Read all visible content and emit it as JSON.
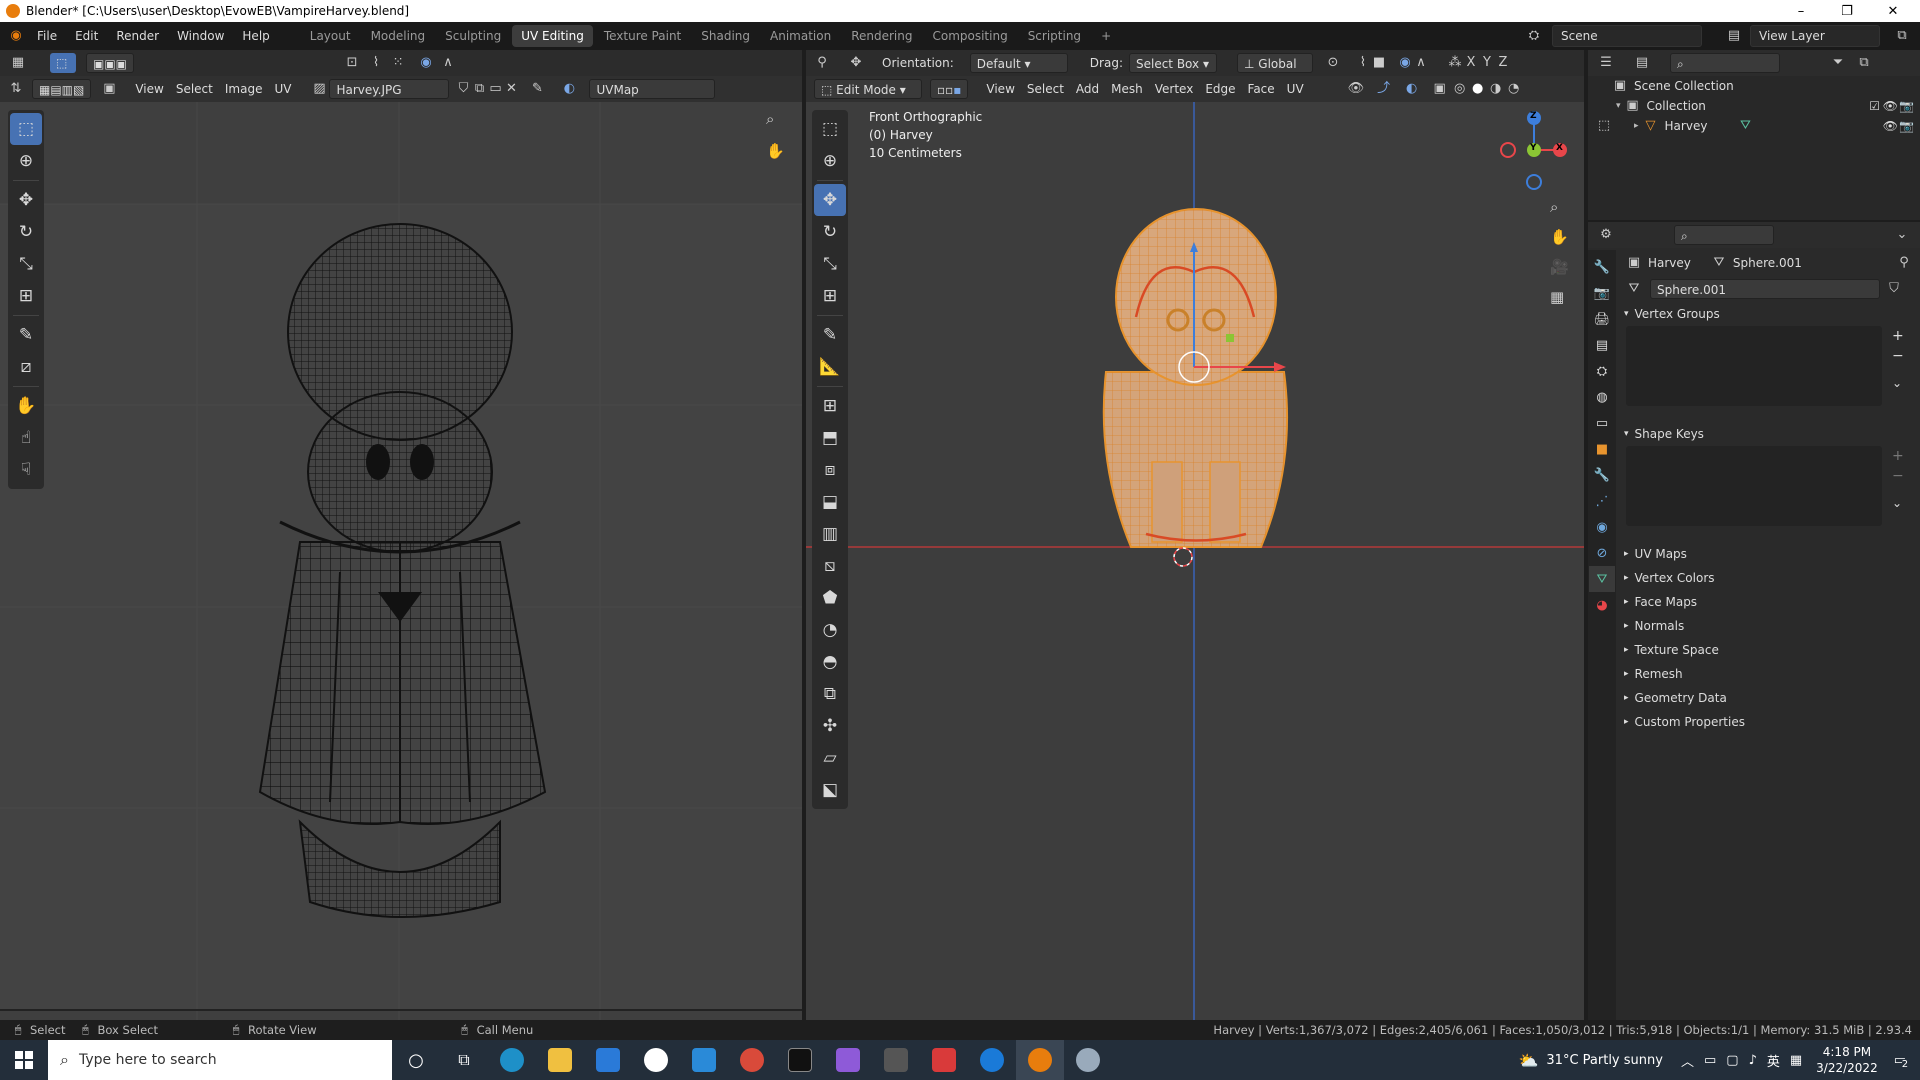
{
  "window": {
    "title": "Blender* [C:\\Users\\user\\Desktop\\EvowEB\\VampireHarvey.blend]",
    "minimize": "–",
    "restore": "❐",
    "close": "✕"
  },
  "menubar": {
    "items": [
      "File",
      "Edit",
      "Render",
      "Window",
      "Help"
    ]
  },
  "workspaces": {
    "tabs": [
      "Layout",
      "Modeling",
      "Sculpting",
      "UV Editing",
      "Texture Paint",
      "Shading",
      "Animation",
      "Rendering",
      "Compositing",
      "Scripting"
    ],
    "active": "UV Editing",
    "add": "+"
  },
  "scene": {
    "label": "Scene",
    "view_layer": "View Layer"
  },
  "uv_editor": {
    "menus": [
      "View",
      "Select",
      "Image",
      "UV"
    ],
    "image_name": "Harvey.JPG",
    "uv_map": "UVMap"
  },
  "viewport": {
    "orientation_label": "Orientation:",
    "orientation_value": "Default",
    "drag_label": "Drag:",
    "drag_value": "Select Box",
    "transform_space": "Global",
    "mode": "Edit Mode",
    "menus": [
      "View",
      "Select",
      "Add",
      "Mesh",
      "Vertex",
      "Edge",
      "Face",
      "UV"
    ],
    "overlay_line1": "Front Orthographic",
    "overlay_line2": "(0) Harvey",
    "overlay_line3": "10 Centimeters",
    "axis_x": "X",
    "axis_y": "Y",
    "axis_z": "Z"
  },
  "outliner": {
    "root": "Scene Collection",
    "collection": "Collection",
    "object": "Harvey"
  },
  "properties": {
    "object_name": "Harvey",
    "mesh_name": "Sphere.001",
    "data_field": "Sphere.001",
    "sections": [
      "Vertex Groups",
      "Shape Keys",
      "UV Maps",
      "Vertex Colors",
      "Face Maps",
      "Normals",
      "Texture Space",
      "Remesh",
      "Geometry Data",
      "Custom Properties"
    ]
  },
  "statusbar": {
    "select": "Select",
    "box_select": "Box Select",
    "rotate_view": "Rotate View",
    "call_menu": "Call Menu",
    "stats": "Harvey | Verts:1,367/3,072 | Edges:2,405/6,061 | Faces:1,050/3,012 | Tris:5,918 | Objects:1/1 | Memory: 31.5 MiB | 2.93.4"
  },
  "taskbar": {
    "search_placeholder": "Type here to search",
    "weather": "31°C  Partly sunny",
    "time": "4:18 PM",
    "date": "3/22/2022",
    "notif_count": "2",
    "lang": "英"
  },
  "colors": {
    "accent": "#4772b3",
    "mesh_orange": "#e8a05a",
    "axis_red": "#e8464a",
    "axis_green": "#8bc534",
    "axis_blue": "#3d7edb"
  }
}
